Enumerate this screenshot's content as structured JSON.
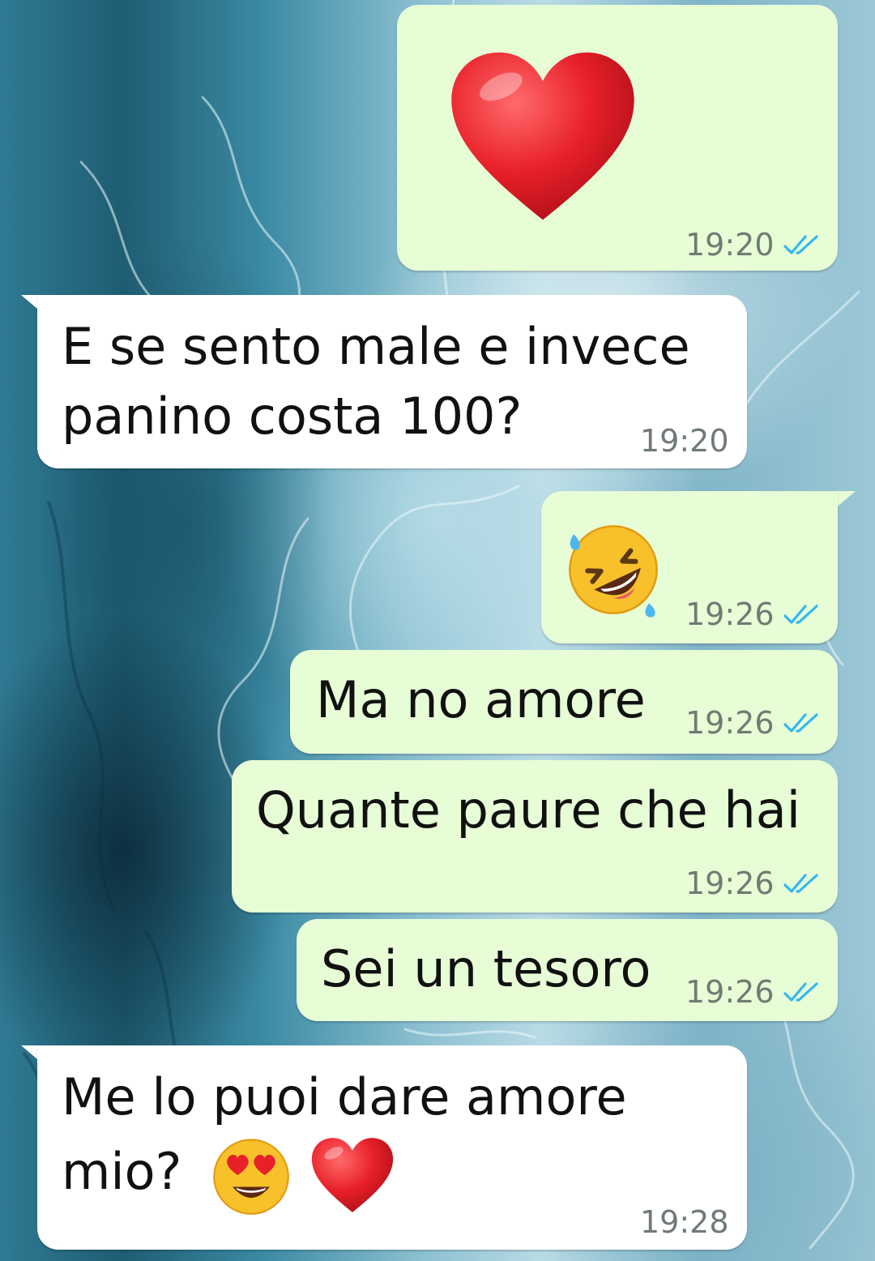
{
  "chat": {
    "messages": [
      {
        "direction": "outgoing",
        "content": "❤️",
        "time": "19:20",
        "status": "read",
        "emoji": "red-heart"
      },
      {
        "direction": "incoming",
        "lines": [
          "E se sento male e invece",
          "panino costa 100?"
        ],
        "time": "19:20"
      },
      {
        "direction": "outgoing",
        "content": "🤣",
        "time": "19:26",
        "status": "read",
        "emoji": "rolling-on-floor-laughing"
      },
      {
        "direction": "outgoing",
        "text": "Ma no amore",
        "time": "19:26",
        "status": "read"
      },
      {
        "direction": "outgoing",
        "text": "Quante paure che hai",
        "time": "19:26",
        "status": "read"
      },
      {
        "direction": "outgoing",
        "text": "Sei un tesoro",
        "time": "19:26",
        "status": "read"
      },
      {
        "direction": "incoming",
        "lines": [
          "Me lo puoi dare amore",
          "mio?"
        ],
        "emojis": [
          "heart-eyes",
          "red-heart"
        ],
        "time": "19:28"
      }
    ]
  },
  "colors": {
    "outgoing_bubble": "#e7fdd6",
    "incoming_bubble": "#ffffff",
    "read_ticks": "#34b7f1",
    "timestamp": "#6f7b72"
  }
}
